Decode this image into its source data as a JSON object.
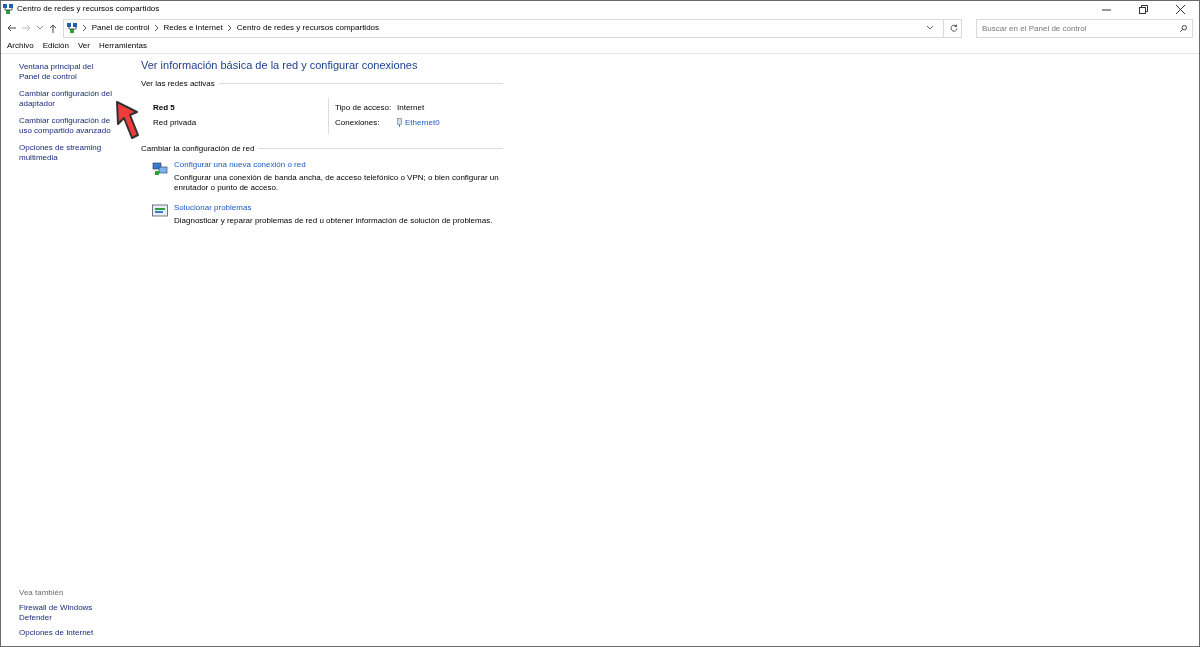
{
  "window": {
    "title": "Centro de redes y recursos compartidos"
  },
  "address_bar": {
    "breadcrumbs": [
      "Panel de control",
      "Redes e Internet",
      "Centro de redes y recursos compartidos"
    ],
    "search": {
      "placeholder": "Buscar en el Panel de control"
    }
  },
  "menu": [
    "Archivo",
    "Edición",
    "Ver",
    "Herramientas"
  ],
  "sidebar": {
    "links": [
      "Ventana principal del Panel de control",
      "Cambiar configuración del adaptador",
      "Cambiar configuración de uso compartido avanzado",
      "Opciones de streaming multimedia"
    ],
    "see_also": {
      "title": "Vea también",
      "links": [
        "Firewall de Windows Defender",
        "Opciones de Internet"
      ]
    }
  },
  "main": {
    "heading": "Ver información básica de la red y configurar conexiones",
    "active_networks": {
      "title": "Ver las redes activas",
      "name": "Red 5",
      "profile": "Red privada",
      "access_label": "Tipo de acceso:",
      "access_value": "Internet",
      "connections_label": "Conexiones:",
      "connection": "Ethernet0"
    },
    "change_settings": {
      "title": "Cambiar la configuración de red",
      "tasks": [
        {
          "kind": "new-connection",
          "link": "Configurar una nueva conexión o red",
          "description": "Configurar una conexión de banda ancha, de acceso telefónico o VPN; o bien configurar un enrutador o punto de acceso."
        },
        {
          "kind": "troubleshoot",
          "link": "Solucionar problemas",
          "description": "Diagnosticar y reparar problemas de red u obtener información de solución de problemas."
        }
      ]
    }
  }
}
